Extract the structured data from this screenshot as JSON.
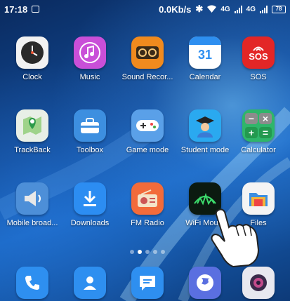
{
  "status_bar": {
    "time": "17:18",
    "net_speed": "0.0Kb/s",
    "sim1": "4G",
    "sim2": "4G",
    "battery": "78"
  },
  "apps": [
    {
      "label": "Clock",
      "icon": "clock-icon",
      "color": "#f2f2f2"
    },
    {
      "label": "Music",
      "icon": "music-icon",
      "color": "#c94fd8"
    },
    {
      "label": "Sound Recor...",
      "icon": "sound-recorder-icon",
      "color": "#f08a1e"
    },
    {
      "label": "Calendar",
      "icon": "calendar-icon",
      "color": "#ffffff",
      "day": "31"
    },
    {
      "label": "SOS",
      "icon": "sos-icon",
      "color": "#e32626",
      "text": "SOS"
    },
    {
      "label": "TrackBack",
      "icon": "trackback-icon",
      "color": "#e8efe6"
    },
    {
      "label": "Toolbox",
      "icon": "toolbox-icon",
      "color": "#3d8fe0"
    },
    {
      "label": "Game mode",
      "icon": "game-mode-icon",
      "color": "#5aa0e8"
    },
    {
      "label": "Student mode",
      "icon": "student-mode-icon",
      "color": "#2aa9f0"
    },
    {
      "label": "Calculator",
      "icon": "calculator-icon",
      "color": "#2fb66a"
    },
    {
      "label": "Mobile broad...",
      "icon": "mobile-broadcast-icon",
      "color": "#4d8fd8"
    },
    {
      "label": "Downloads",
      "icon": "downloads-icon",
      "color": "#2c8df2"
    },
    {
      "label": "FM Radio",
      "icon": "fm-radio-icon",
      "color": "#f26b3a"
    },
    {
      "label": "WiFi Mou...",
      "icon": "wifi-mouse-icon",
      "color": "#0b1a10"
    },
    {
      "label": "Files",
      "icon": "files-icon",
      "color": "#f4f4f4"
    }
  ],
  "dock": [
    {
      "icon": "phone-icon",
      "color": "#2e8ff0"
    },
    {
      "icon": "contacts-icon",
      "color": "#2e8ff0"
    },
    {
      "icon": "messages-icon",
      "color": "#2e8ff0"
    },
    {
      "icon": "browser-icon",
      "color": "#5a6fe0"
    },
    {
      "icon": "camera-icon",
      "color": "#e8e8ef"
    }
  ],
  "page_indicator": {
    "count": 5,
    "active": 1
  }
}
